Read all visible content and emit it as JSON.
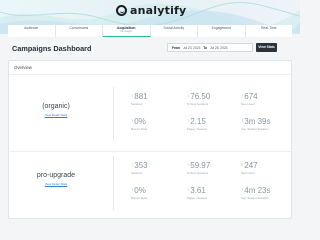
{
  "app": {
    "logo_text": "analytify",
    "logo_icon": "analytify-logo-icon"
  },
  "colors": {
    "accent": "#27c08a",
    "button_dark": "#2b3238",
    "link": "#2f7ec6"
  },
  "nav": {
    "tabs": [
      {
        "label": "Audience",
        "sub": "",
        "active": false
      },
      {
        "label": "Conversions",
        "sub": "",
        "active": false
      },
      {
        "label": "Acquisition",
        "sub": "Campaigns",
        "active": true
      },
      {
        "label": "Social Activity",
        "sub": "",
        "active": false
      },
      {
        "label": "Engagement",
        "sub": "",
        "active": false
      },
      {
        "label": "Real-Time",
        "sub": "",
        "active": false
      }
    ]
  },
  "page": {
    "title": "Campaigns Dashboard"
  },
  "daterange": {
    "from_label": "From",
    "from_value": "Jul 23, 2023",
    "to_label": "To",
    "to_value": "Jul 25, 2023"
  },
  "view_button": "View Stats",
  "overview": {
    "heading": "Overview",
    "campaigns": [
      {
        "name": "(organic)",
        "link_text": "View Detail Stats",
        "metrics": [
          {
            "value": "881",
            "label": "Sessions"
          },
          {
            "value": "76.50",
            "label": "% New Sessions"
          },
          {
            "value": "674",
            "label": "New Users"
          },
          {
            "value": "0%",
            "label": "Bounce Rate"
          },
          {
            "value": "2.15",
            "label": "Pages / Session"
          },
          {
            "value": "3m 39s",
            "label": "Avg. Session Duration"
          }
        ]
      },
      {
        "name": "pro-upgrade",
        "link_text": "View Detail Stats",
        "metrics": [
          {
            "value": "353",
            "label": "Sessions"
          },
          {
            "value": "59.97",
            "label": "% New Sessions"
          },
          {
            "value": "247",
            "label": "New Users"
          },
          {
            "value": "0%",
            "label": "Bounce Rate"
          },
          {
            "value": "3.61",
            "label": "Pages / Session"
          },
          {
            "value": "4m 23s",
            "label": "Avg. Session Duration"
          }
        ]
      }
    ]
  }
}
